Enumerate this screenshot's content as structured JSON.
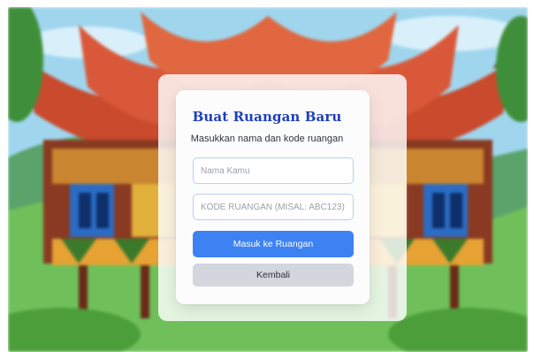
{
  "form": {
    "title": "Buat Ruangan Baru",
    "subtitle": "Masukkan nama dan kode ruangan",
    "name_placeholder": "Nama Kamu",
    "code_placeholder": "KODE RUANGAN (MISAL: ABC123)",
    "enter_label": "Masuk ke Ruangan",
    "back_label": "Kembali"
  },
  "colors": {
    "title": "#1d3fbb",
    "primary_button": "#3d82f3",
    "secondary_button": "#d3d6dc",
    "field_border": "#b9d0f3"
  }
}
